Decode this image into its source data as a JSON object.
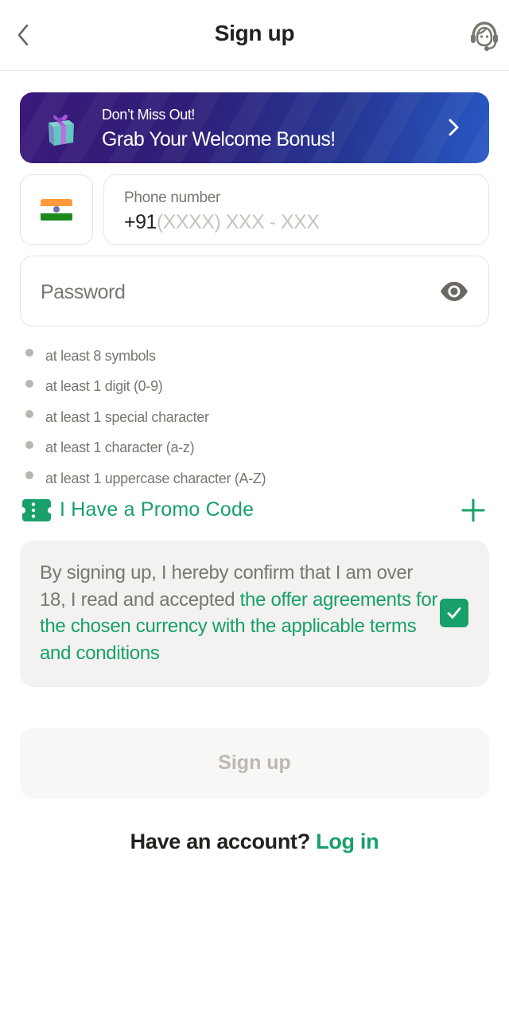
{
  "header": {
    "title": "Sign up",
    "back_icon": "chevron-left-icon",
    "support_icon": "customer-support-headset-icon"
  },
  "banner": {
    "subtitle": "Don’t Miss Out!",
    "title": "Grab Your Welcome Bonus!",
    "icon": "gift-icon",
    "arrow_icon": "chevron-right-icon"
  },
  "phone": {
    "country_flag": "india-flag",
    "label": "Phone number",
    "prefix": "+91",
    "placeholder": "(XXXX) XXX - XXX"
  },
  "password": {
    "placeholder": "Password",
    "toggle_icon": "eye-icon"
  },
  "password_rules": [
    "at least 8 symbols",
    "at least 1 digit (0-9)",
    "at least 1 special character",
    "at least 1 character (a-z)",
    "at least 1 uppercase character (A-Z)"
  ],
  "promo": {
    "label": "I Have a Promo Code",
    "icon": "ticket-icon",
    "expand_icon": "plus-icon"
  },
  "terms": {
    "text_plain": "By signing up, I hereby confirm that I am over 18, I read and accepted ",
    "text_link": "the offer agreements for the chosen currency with the applicable terms and conditions",
    "checked": true
  },
  "signup_button": {
    "label": "Sign up",
    "enabled": false
  },
  "login": {
    "question": "Have an account?",
    "link": "Log in"
  },
  "colors": {
    "accent_green": "#17a06a",
    "text_primary": "#23211e",
    "text_secondary": "#7a7670",
    "banner_start": "#3a1a7a",
    "banner_end": "#2858c4"
  }
}
